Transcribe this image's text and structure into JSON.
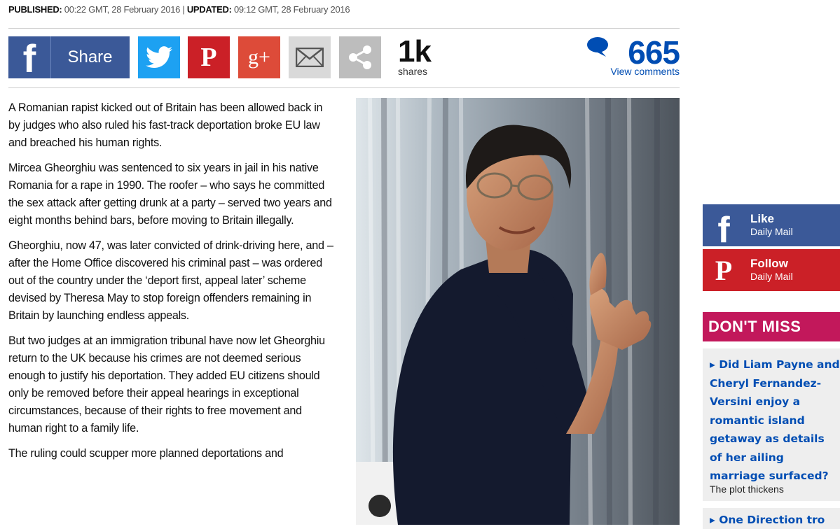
{
  "header": {
    "published_label": "PUBLISHED:",
    "published_value": "00:22 GMT, 28 February 2016",
    "separator": "|",
    "updated_label": "UPDATED:",
    "updated_value": "09:12 GMT, 28 February 2016"
  },
  "share": {
    "facebook_label": "Share",
    "count": "1k",
    "count_label": "shares",
    "icons": [
      "facebook-icon",
      "twitter-icon",
      "pinterest-icon",
      "google-plus-icon",
      "email-icon",
      "share-icon"
    ],
    "google_plus_glyph": "g+",
    "pinterest_glyph": "P",
    "facebook_glyph": "f"
  },
  "comments": {
    "count": "665",
    "link": "View comments",
    "color": "#004db3"
  },
  "article": {
    "paragraphs": [
      "A Romanian rapist kicked out of Britain has been allowed back in by judges who also ruled his fast-track deportation broke EU law and breached his human rights.",
      "Mircea Gheorghiu was sentenced to six years in jail in his native Romania for a rape in 1990. The roofer – who says he committed the sex attack after getting drunk at a party – served two years and eight months behind bars, before moving to Britain illegally.",
      "Gheorghiu, now 47, was later convicted of drink-driving here, and – after the Home Office discovered his criminal past – was ordered out of the country under the ‘deport first, appeal later’ scheme devised by Theresa May to stop foreign offenders remaining in Britain by launching endless appeals.",
      "But two judges at an immigration tribunal have now let Gheorghiu return to the UK because his crimes are not deemed serious enough to justify his deportation. They added EU citizens should only be removed before their appeal hearings in exceptional circumstances, because of their rights to free movement and human right to a family life.",
      "The ruling could scupper more planned deportations and"
    ]
  },
  "sidebar": {
    "facebook": {
      "action": "Like",
      "account": "Daily Mail",
      "glyph": "f"
    },
    "pinterest": {
      "action": "Follow",
      "account": "Daily Mail",
      "glyph": "P"
    },
    "dont_miss_title": "DON'T MISS",
    "dont_miss_color": "#c2185b",
    "items": [
      {
        "lines": [
          "Did Liam Payne and",
          "Cheryl Fernandez-",
          "Versini enjoy a",
          "romantic island",
          "getaway as details",
          "of her ailing",
          "marriage surfaced?"
        ],
        "subtitle": "The plot thickens"
      },
      {
        "lines": [
          "One Direction tro"
        ]
      }
    ]
  },
  "colors": {
    "facebook": "#3b5998",
    "twitter": "#1da1f2",
    "pinterest": "#cb2027",
    "google_plus": "#dd4b39",
    "email": "#d9d9d9",
    "share": "#bdbdbd",
    "link": "#004db3"
  }
}
